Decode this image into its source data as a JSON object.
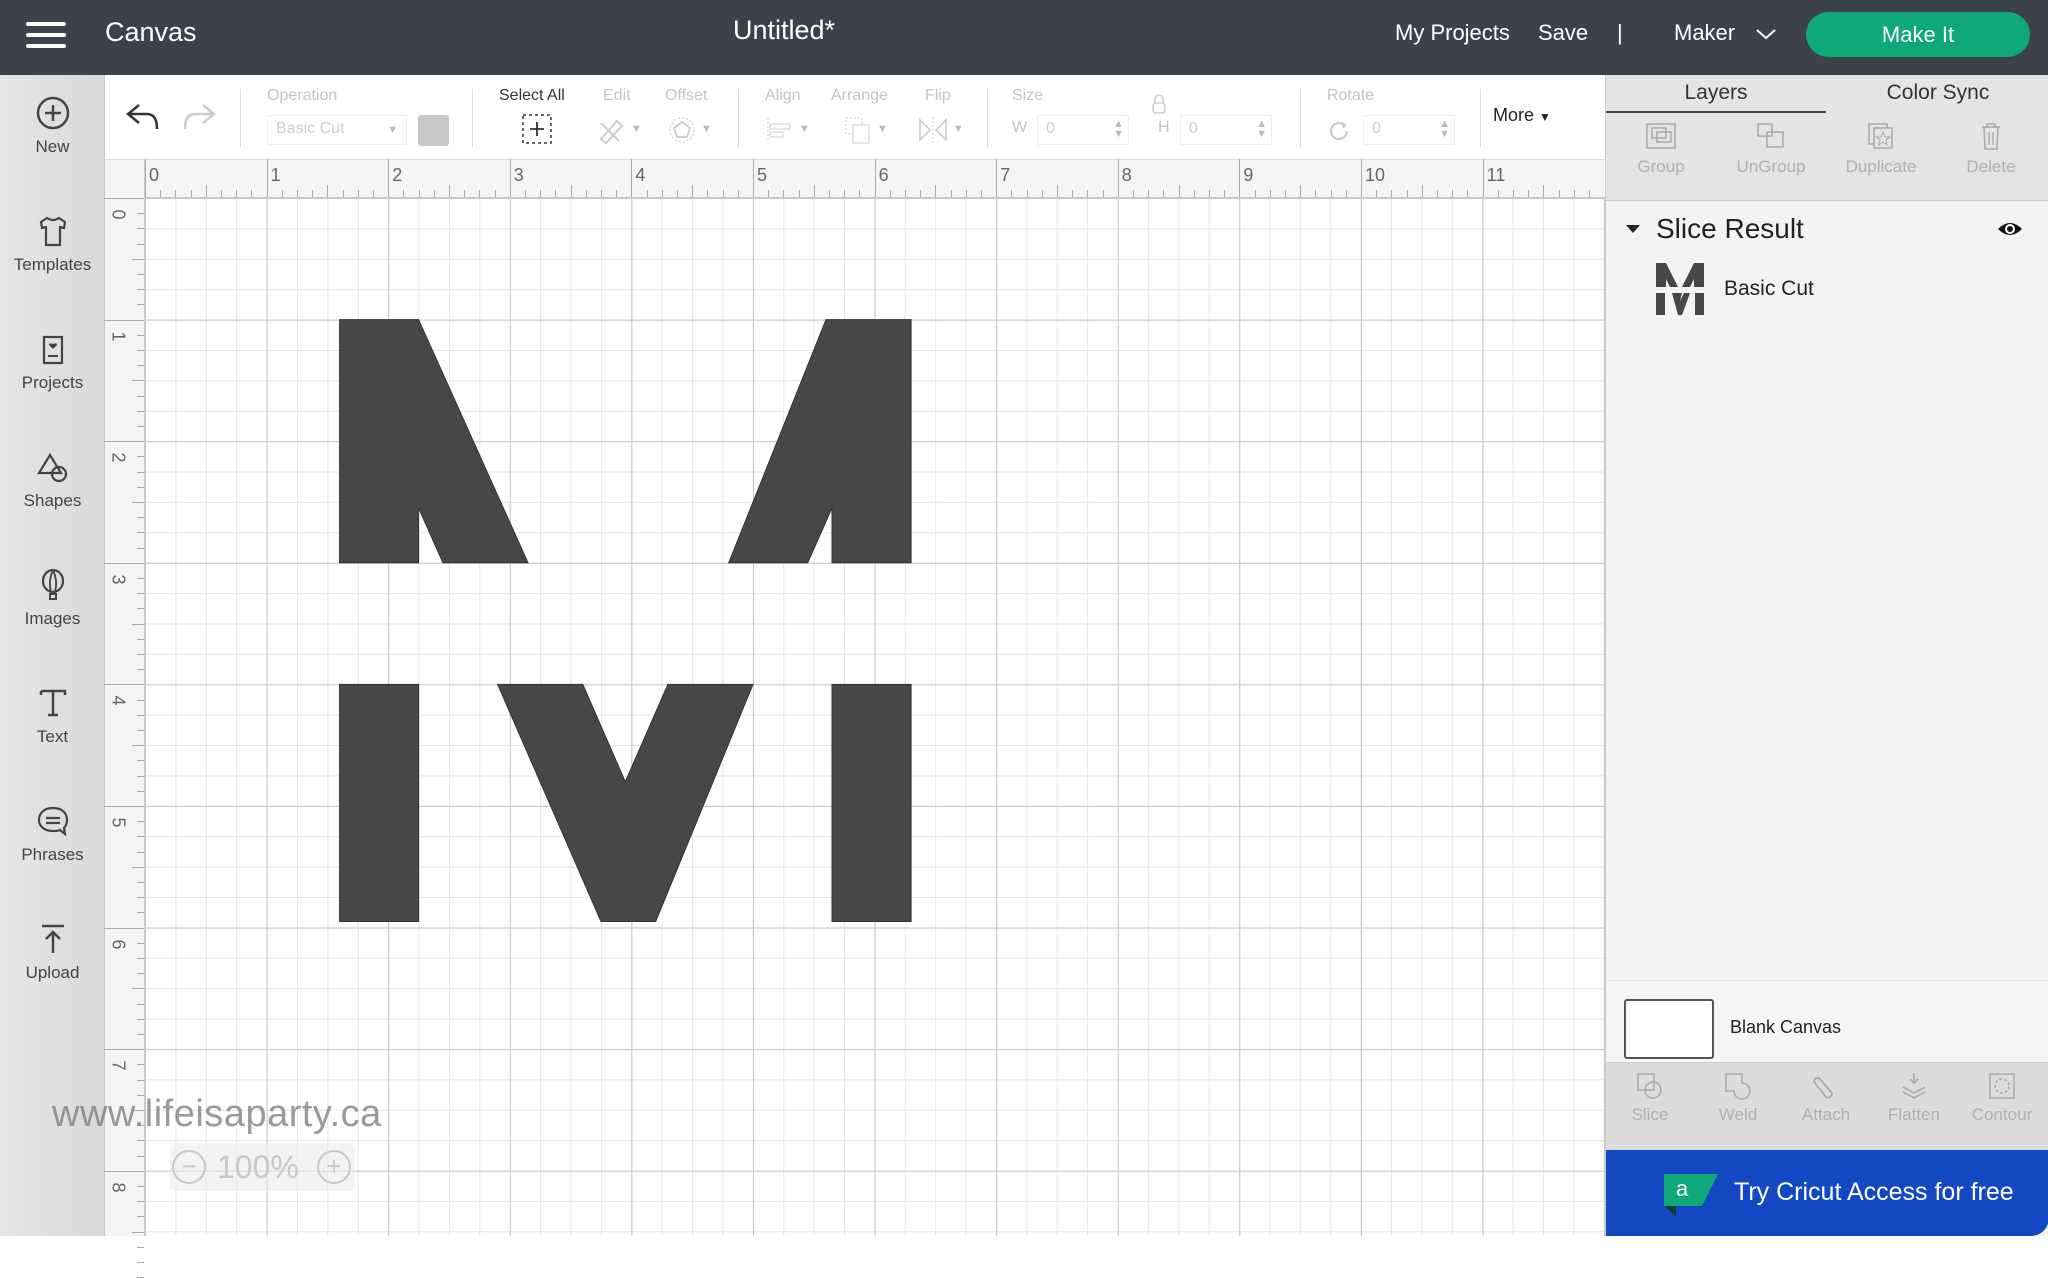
{
  "header": {
    "app_title": "Canvas",
    "document_title": "Untitled*",
    "my_projects": "My Projects",
    "save": "Save",
    "divider": "|",
    "machine": "Maker",
    "make_it": "Make It",
    "colors": {
      "bar": "#3d424a",
      "make_it": "#0fa878"
    }
  },
  "sidebar": {
    "items": [
      {
        "label": "New",
        "icon": "plus-circle-icon"
      },
      {
        "label": "Templates",
        "icon": "tshirt-icon"
      },
      {
        "label": "Projects",
        "icon": "card-heart-icon"
      },
      {
        "label": "Shapes",
        "icon": "shapes-icon"
      },
      {
        "label": "Images",
        "icon": "balloon-icon"
      },
      {
        "label": "Text",
        "icon": "text-icon"
      },
      {
        "label": "Phrases",
        "icon": "speech-bubble-icon"
      },
      {
        "label": "Upload",
        "icon": "upload-icon"
      }
    ]
  },
  "toolbar": {
    "operation_label": "Operation",
    "operation_value": "Basic Cut",
    "select_all": "Select All",
    "edit": "Edit",
    "offset": "Offset",
    "align": "Align",
    "arrange": "Arrange",
    "flip": "Flip",
    "size": "Size",
    "w_label": "W",
    "w_value": "0",
    "h_label": "H",
    "h_value": "0",
    "rotate": "Rotate",
    "rotate_value": "0",
    "more": "More"
  },
  "rulers": {
    "horizontal": [
      "0",
      "1",
      "2",
      "3",
      "4",
      "5",
      "6",
      "7",
      "8",
      "9",
      "10",
      "11"
    ],
    "vertical": [
      "0",
      "1",
      "2",
      "3",
      "4",
      "5",
      "6",
      "7",
      "8"
    ],
    "unit": "in"
  },
  "canvas": {
    "shape_color": "#474747",
    "pieces": [
      {
        "name": "top-left-piece",
        "points_in": [
          [
            1.6,
            1.0
          ],
          [
            2.25,
            1.0
          ],
          [
            3.15,
            3.0
          ],
          [
            2.45,
            3.0
          ],
          [
            2.25,
            2.55
          ],
          [
            2.25,
            3.0
          ],
          [
            1.6,
            3.0
          ]
        ]
      },
      {
        "name": "top-right-piece",
        "points_in": [
          [
            5.6,
            1.0
          ],
          [
            6.3,
            1.0
          ],
          [
            6.3,
            3.0
          ],
          [
            5.65,
            3.0
          ],
          [
            5.65,
            2.55
          ],
          [
            5.45,
            3.0
          ],
          [
            4.8,
            3.0
          ]
        ]
      },
      {
        "name": "bottom-left-bar",
        "points_in": [
          [
            1.6,
            4.0
          ],
          [
            2.25,
            4.0
          ],
          [
            2.25,
            5.95
          ],
          [
            1.6,
            5.95
          ]
        ]
      },
      {
        "name": "bottom-v",
        "points_in": [
          [
            2.9,
            4.0
          ],
          [
            3.6,
            4.0
          ],
          [
            3.95,
            4.8
          ],
          [
            4.3,
            4.0
          ],
          [
            5.0,
            4.0
          ],
          [
            4.2,
            5.95
          ],
          [
            3.75,
            5.95
          ]
        ]
      },
      {
        "name": "bottom-right-bar",
        "points_in": [
          [
            5.65,
            4.0
          ],
          [
            6.3,
            4.0
          ],
          [
            6.3,
            5.95
          ],
          [
            5.65,
            5.95
          ]
        ]
      }
    ]
  },
  "watermark": "www.lifeisaparty.ca",
  "zoom": {
    "value": "100%",
    "minus": "−",
    "plus": "+"
  },
  "right_panel": {
    "tabs": [
      {
        "label": "Layers",
        "active": true
      },
      {
        "label": "Color Sync",
        "active": false
      }
    ],
    "layer_actions": [
      "Group",
      "UnGroup",
      "Duplicate",
      "Delete"
    ],
    "group": {
      "title": "Slice Result",
      "visible": true
    },
    "layers": [
      {
        "name": "Basic Cut",
        "thumbnail": "M-slice-thumbnail"
      }
    ],
    "blank_canvas": "Blank Canvas",
    "combine_actions": [
      "Slice",
      "Weld",
      "Attach",
      "Flatten",
      "Contour"
    ],
    "access_banner": "Try Cricut Access for free",
    "access_logo_letter": "a",
    "colors": {
      "banner": "#1448c2",
      "logo": "#0fa878"
    }
  }
}
